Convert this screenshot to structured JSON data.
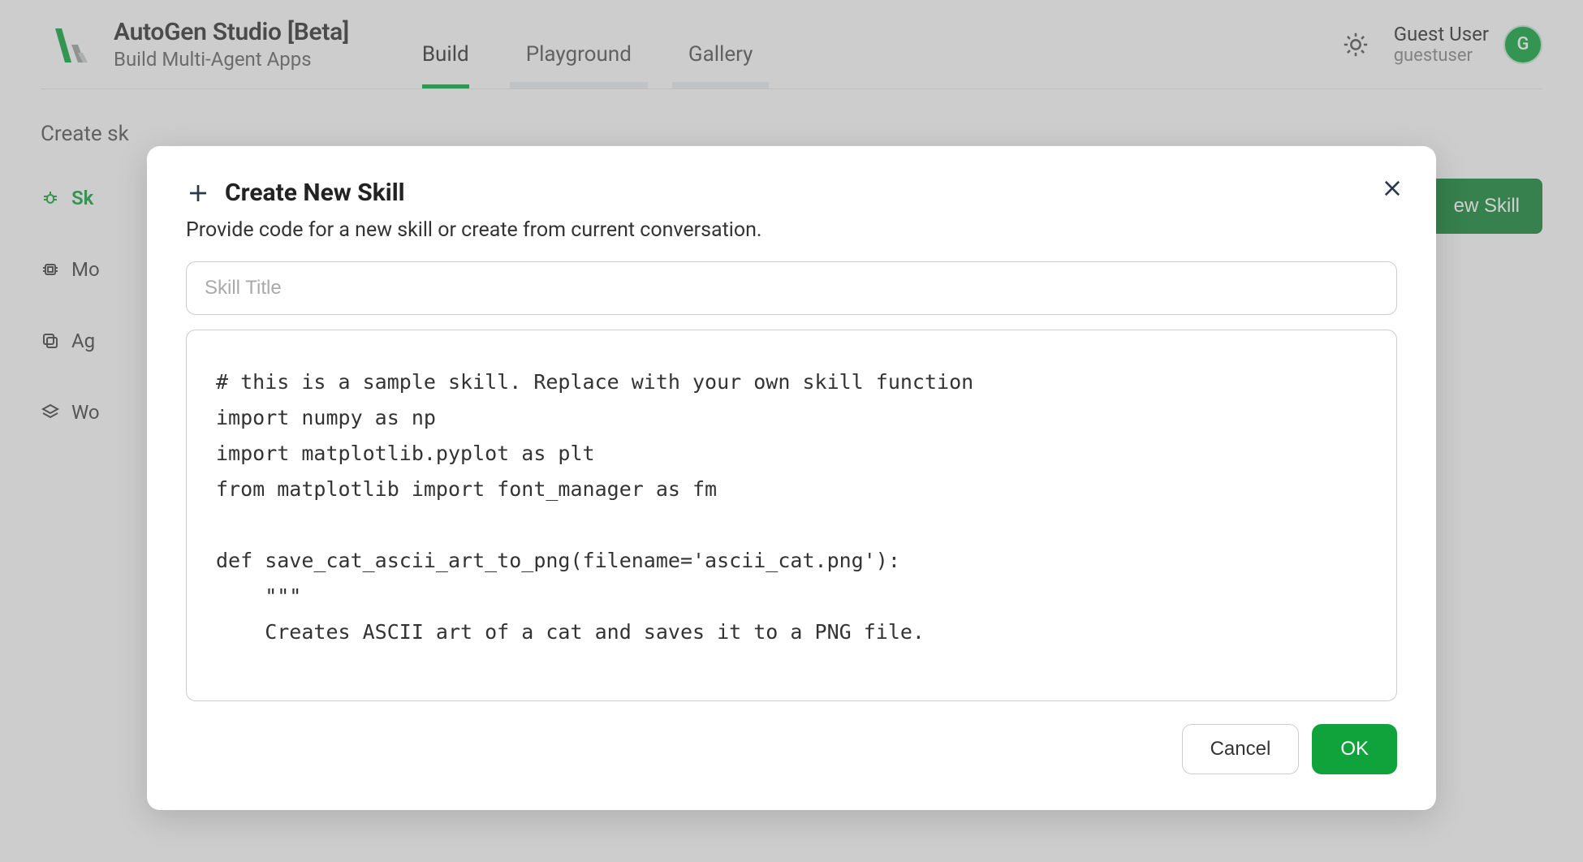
{
  "header": {
    "app_title": "AutoGen Studio [Beta]",
    "app_subtitle": "Build Multi-Agent Apps",
    "tabs": [
      {
        "label": "Build",
        "active": true
      },
      {
        "label": "Playground",
        "active": false
      },
      {
        "label": "Gallery",
        "active": false
      }
    ],
    "user_name": "Guest User",
    "user_handle": "guestuser",
    "avatar_initial": "G"
  },
  "page": {
    "title_partial": "Create sk",
    "new_skill_button_partial": "ew Skill"
  },
  "sidebar": {
    "items": [
      {
        "label_partial": "Sk",
        "icon": "bug-icon",
        "active": true
      },
      {
        "label_partial": "Mo",
        "icon": "chip-icon",
        "active": false
      },
      {
        "label_partial": "Ag",
        "icon": "copy-icon",
        "active": false
      },
      {
        "label_partial": "Wo",
        "icon": "layers-icon",
        "active": false
      }
    ]
  },
  "modal": {
    "title": "Create New Skill",
    "description": "Provide code for a new skill or create from current conversation.",
    "skill_title_placeholder": "Skill Title",
    "skill_title_value": "",
    "code_value": "# this is a sample skill. Replace with your own skill function\nimport numpy as np\nimport matplotlib.pyplot as plt\nfrom matplotlib import font_manager as fm\n\ndef save_cat_ascii_art_to_png(filename='ascii_cat.png'):\n    \"\"\"\n    Creates ASCII art of a cat and saves it to a PNG file.",
    "cancel_label": "Cancel",
    "ok_label": "OK"
  },
  "colors": {
    "brand_green": "#10a33c",
    "brand_green_dark": "#138636"
  }
}
